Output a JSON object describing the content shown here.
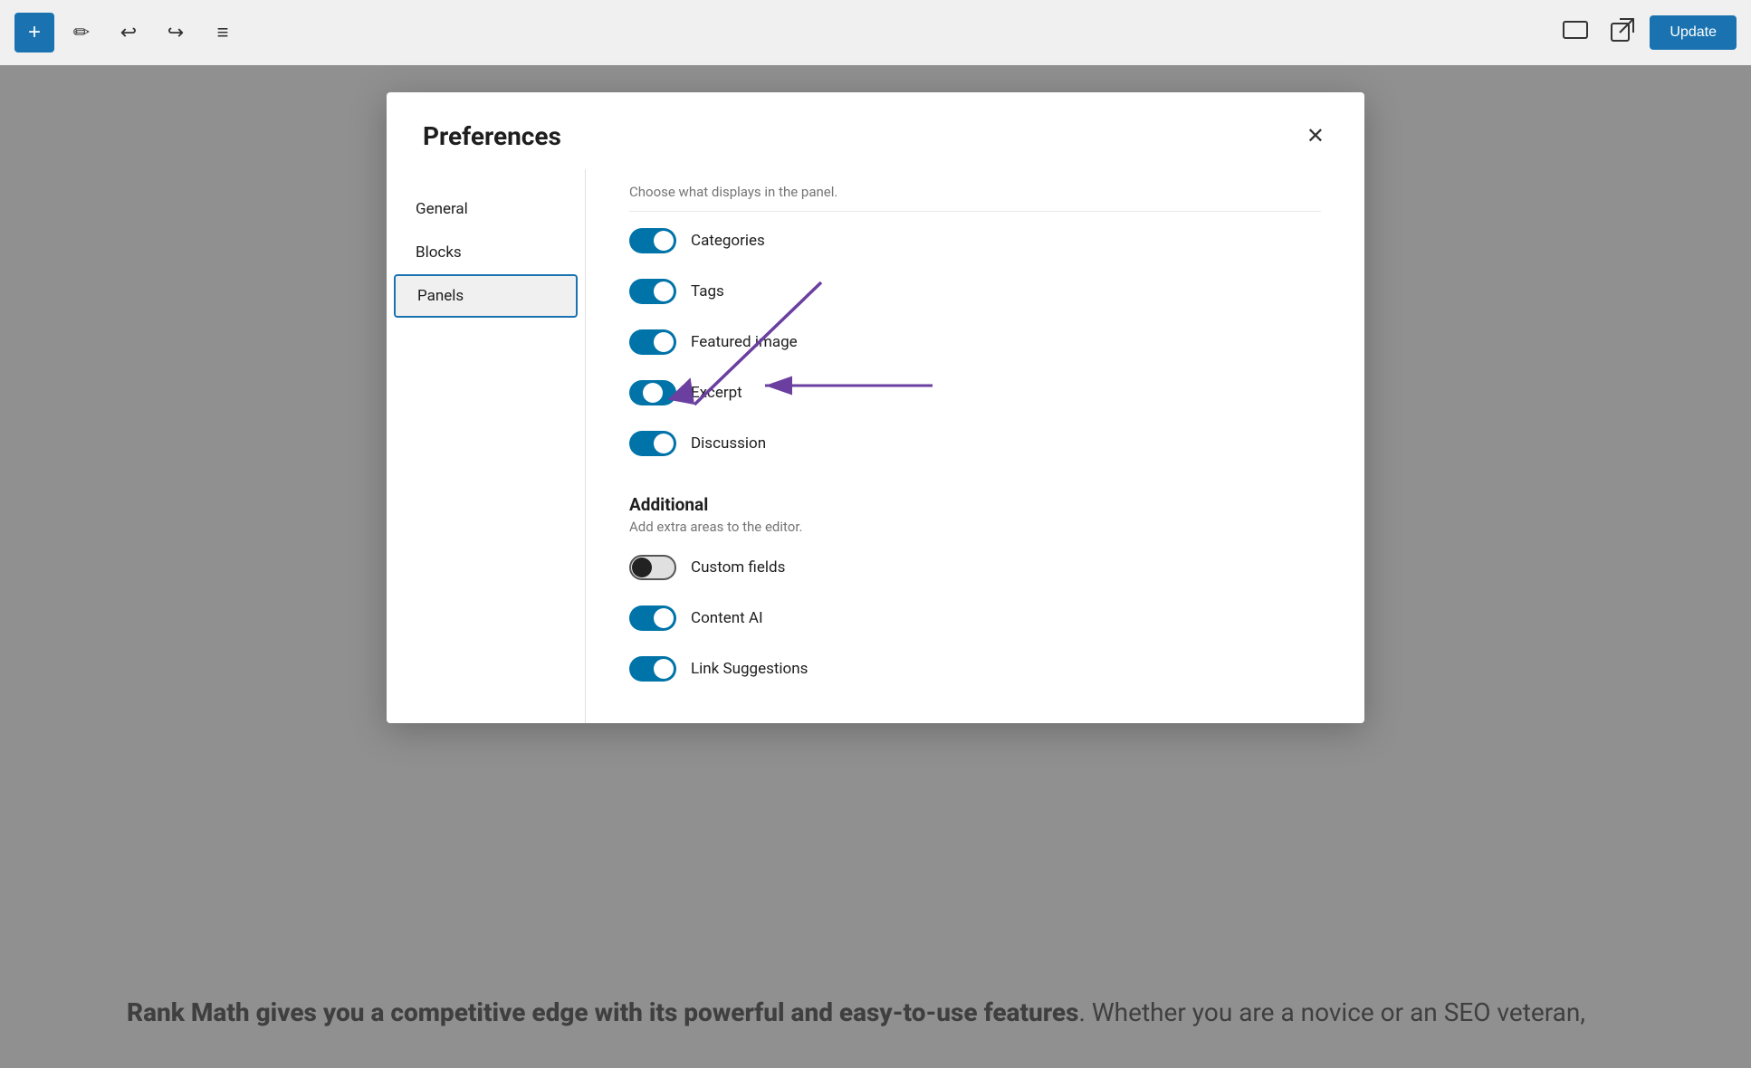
{
  "toolbar": {
    "add_label": "+",
    "pencil_label": "✎",
    "undo_label": "↩",
    "redo_label": "↪",
    "list_label": "≡",
    "preview_label": "⬜",
    "external_label": "⬡",
    "update_label": "Update"
  },
  "background": {
    "text_bold": "Rank Math gives you a competitive edge with its powerful and easy-to-use features",
    "text_normal": ". Whether you are a novice or an SEO veteran,"
  },
  "modal": {
    "title": "Preferences",
    "close_label": "✕",
    "sidebar": {
      "items": [
        {
          "id": "general",
          "label": "General"
        },
        {
          "id": "blocks",
          "label": "Blocks"
        },
        {
          "id": "panels",
          "label": "Panels",
          "active": true
        }
      ]
    },
    "panels_section": {
      "header": "Choose what displays in the panel.",
      "toggles": [
        {
          "id": "categories",
          "label": "Categories",
          "state": "on"
        },
        {
          "id": "tags",
          "label": "Tags",
          "state": "on"
        },
        {
          "id": "featured_image",
          "label": "Featured image",
          "state": "on"
        },
        {
          "id": "excerpt",
          "label": "Excerpt",
          "state": "half"
        },
        {
          "id": "discussion",
          "label": "Discussion",
          "state": "on"
        }
      ]
    },
    "additional_section": {
      "title": "Additional",
      "desc": "Add extra areas to the editor.",
      "toggles": [
        {
          "id": "custom_fields",
          "label": "Custom fields",
          "state": "off_dark"
        },
        {
          "id": "content_ai",
          "label": "Content AI",
          "state": "on"
        },
        {
          "id": "link_suggestions",
          "label": "Link Suggestions",
          "state": "on"
        }
      ]
    }
  }
}
